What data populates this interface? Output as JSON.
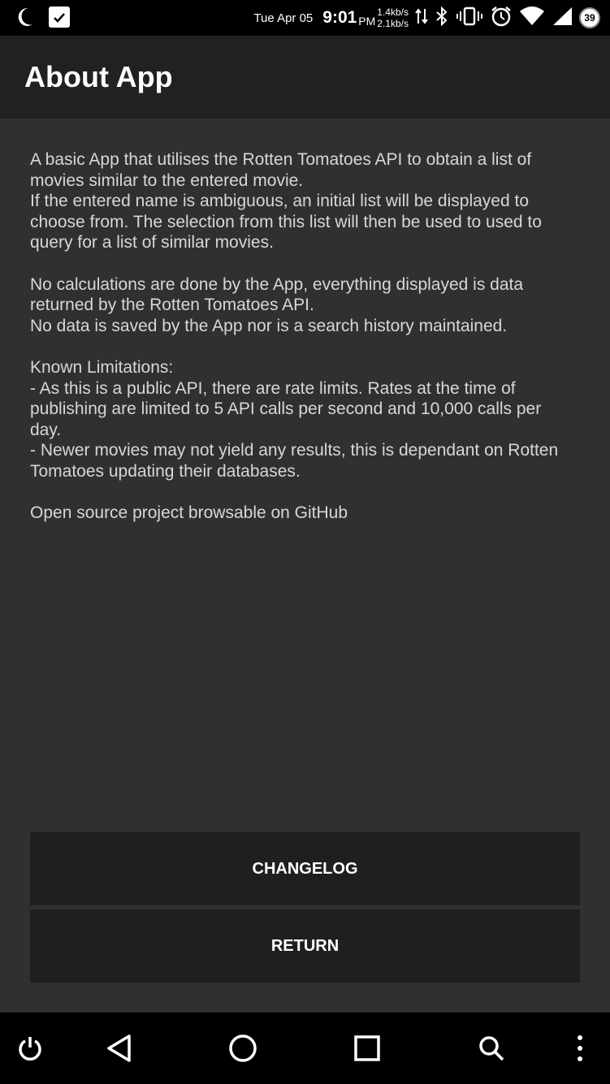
{
  "status_bar": {
    "date": "Tue Apr 05",
    "time": "9:01",
    "ampm": "PM",
    "upload_speed": "1.4kb/s",
    "download_speed": "2.1kb/s",
    "battery_level": "39"
  },
  "app_bar": {
    "title": "About App"
  },
  "content": {
    "paragraph1": [
      "A basic App that utilises the Rotten Tomatoes API to obtain a list of",
      "movies similar to the entered movie.",
      "If the entered name is ambiguous, an initial list will be displayed to",
      "choose from. The selection from this list will then be used to used to",
      "query for a list of similar movies."
    ],
    "paragraph2": [
      "No calculations are done by the App, everything displayed is data",
      "returned by the Rotten Tomatoes API.",
      "No data is saved by the App nor is a search history maintained."
    ],
    "paragraph3": [
      "Known Limitations:",
      "- As this is a public API, there are rate limits. Rates at the time of",
      "publishing are limited to 5 API calls per second and 10,000 calls per",
      "day.",
      "- Newer movies may not yield any results, this is dependant on Rotten",
      "Tomatoes updating their databases."
    ],
    "paragraph4": [
      "Open source project browsable on GitHub"
    ]
  },
  "buttons": {
    "changelog": "CHANGELOG",
    "return": "RETURN"
  },
  "nav_bar": {
    "icons": [
      "power-icon",
      "back-icon",
      "home-icon",
      "recents-icon",
      "search-icon",
      "more-vert-icon"
    ]
  },
  "colors": {
    "background": "#303030",
    "app_bar": "#212121",
    "button": "#1f1f1f",
    "text": "#d7d7d7"
  }
}
